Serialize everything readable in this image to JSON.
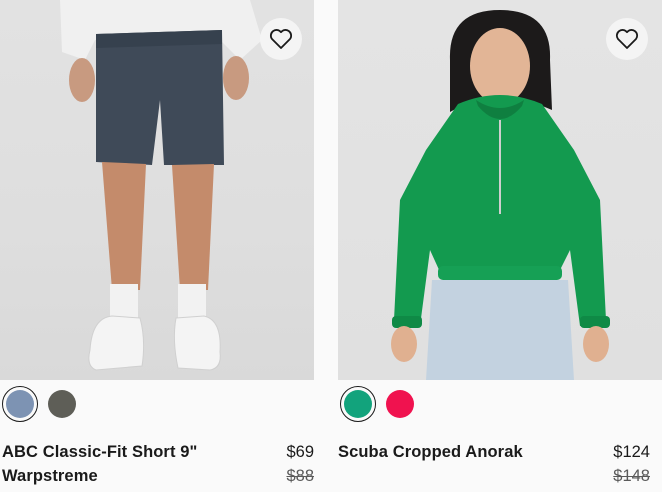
{
  "products": [
    {
      "title": "ABC Classic-Fit Short 9\" Warpstreme",
      "price_current": "$69",
      "price_original": "$88",
      "wishlist_icon": "heart-outline-icon",
      "swatches": [
        {
          "color": "#7d93b3",
          "selected": true
        },
        {
          "color": "#5e5e57",
          "selected": false
        }
      ]
    },
    {
      "title": "Scuba Cropped Anorak",
      "price_current": "$124",
      "price_original": "$148",
      "wishlist_icon": "heart-outline-icon",
      "swatches": [
        {
          "color": "#12a37c",
          "selected": true
        },
        {
          "color": "#f0124f",
          "selected": false
        }
      ]
    }
  ]
}
